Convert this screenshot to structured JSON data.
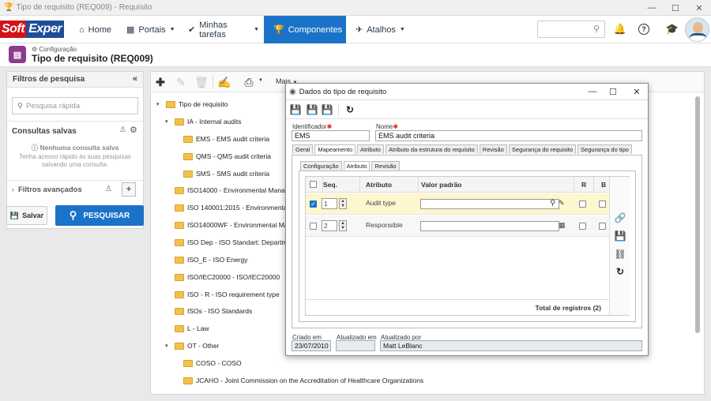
{
  "window": {
    "title": "Tipo de requisito (REQ009) - Requisito"
  },
  "navbar": {
    "logo_part1": "Soft",
    "logo_part2": "Exper",
    "items": [
      {
        "label": "Home"
      },
      {
        "label": "Portais"
      },
      {
        "label": "Minhas tarefas"
      },
      {
        "label": "Componentes"
      },
      {
        "label": "Atalhos"
      }
    ]
  },
  "page": {
    "breadcrumb": "Configuração",
    "title": "Tipo de requisito (REQ009)"
  },
  "filters": {
    "title": "Filtros de pesquisa",
    "search_placeholder": "Pesquisa rápida",
    "saved_title": "Consultas salvas",
    "no_query_title": "Nenhuma consulta salva",
    "no_query_text": "Tenha acesso rápido às suas pesquisas salvando uma consulta.",
    "advanced": "Filtros avançados",
    "save_button": "Salvar",
    "search_button": "PESQUISAR"
  },
  "toolbar": {
    "more": "Mais"
  },
  "tree": {
    "root": "Tipo de requisito",
    "nodes": [
      {
        "label": "IA - Internal audits"
      },
      {
        "label": "EMS - EMS audit criteria"
      },
      {
        "label": "QMS - QMS audit criteria"
      },
      {
        "label": "SMS - SMS audit criteria"
      },
      {
        "label": "ISO14000 - Environmental Managem"
      },
      {
        "label": "ISO 140001:2015 - Environmental M"
      },
      {
        "label": "ISO14000WF - Environmental Mana"
      },
      {
        "label": "ISO Dep - ISO Standart: Department"
      },
      {
        "label": "ISO_E - ISO Energy"
      },
      {
        "label": "ISO/IEC20000 - ISO/IEC20000"
      },
      {
        "label": "ISO - R - ISO requirement type"
      },
      {
        "label": "ISOs - ISO Standards"
      },
      {
        "label": "L - Law"
      },
      {
        "label": "OT - Other"
      },
      {
        "label": "COSO - COSO"
      },
      {
        "label": "JCAHO - Joint Commission on the Accreditation of Healthcare Organizations"
      }
    ]
  },
  "dialog": {
    "title": "Dados do tipo de requisito",
    "identifier_label": "Identificador",
    "identifier_value": "EMS",
    "name_label": "Nome",
    "name_value": "EMS audit criteria",
    "tabs": [
      "Geral",
      "Mapeamento",
      "Atributo",
      "Atributo da estrutura do requisito",
      "Revisão",
      "Segurança do requisito",
      "Segurança do tipo"
    ],
    "subtabs": [
      "Configuração",
      "Atributo",
      "Revisão"
    ],
    "grid": {
      "columns": [
        "Seq.",
        "Atributo",
        "Valor padrão",
        "R",
        "B"
      ],
      "rows": [
        {
          "seq": "1",
          "attribute": "Audit type"
        },
        {
          "seq": "2",
          "attribute": "Responsible"
        }
      ],
      "total": "Total de registros (2)"
    },
    "created_label": "Criado em",
    "created_value": "23/07/2010",
    "updated_label": "Atualizado em",
    "updated_value": "",
    "updated_by_label": "Atualizado por",
    "updated_by_value": "Matt LeBlanc"
  }
}
